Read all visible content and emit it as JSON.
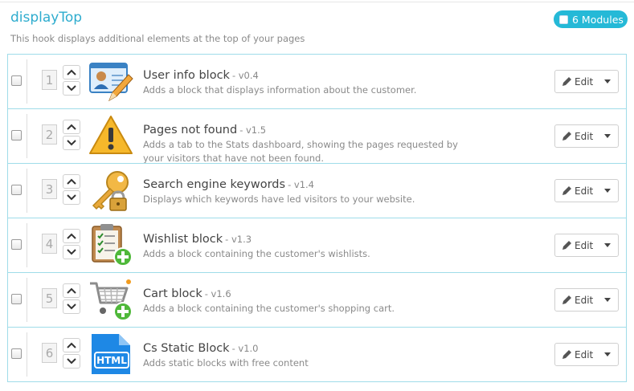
{
  "hook": {
    "title": "displayTop",
    "description": "This hook displays additional elements at the top of your pages",
    "badge": "6 Modules"
  },
  "edit_label": "Edit",
  "modules": [
    {
      "position": "1",
      "name": "User info block",
      "version": "- v0.4",
      "description": "Adds a block that displays information about the customer.",
      "icon": "user-card-icon"
    },
    {
      "position": "2",
      "name": "Pages not found",
      "version": "- v1.5",
      "description": "Adds a tab to the Stats dashboard, showing the pages requested by your visitors that have not been found.",
      "icon": "warning-icon"
    },
    {
      "position": "3",
      "name": "Search engine keywords",
      "version": "- v1.4",
      "description": "Displays which keywords have led visitors to your website.",
      "icon": "key-lock-icon"
    },
    {
      "position": "4",
      "name": "Wishlist block",
      "version": "- v1.3",
      "description": "Adds a block containing the customer's wishlists.",
      "icon": "clipboard-add-icon"
    },
    {
      "position": "5",
      "name": "Cart block",
      "version": "- v1.6",
      "description": "Adds a block containing the customer's shopping cart.",
      "icon": "cart-add-icon"
    },
    {
      "position": "6",
      "name": "Cs Static Block",
      "version": "- v1.0",
      "description": "Adds static blocks with free content",
      "icon": "html-file-icon"
    }
  ],
  "colors": {
    "accent": "#25b9d7",
    "title": "#2eacce",
    "border": "#9fdce9"
  }
}
